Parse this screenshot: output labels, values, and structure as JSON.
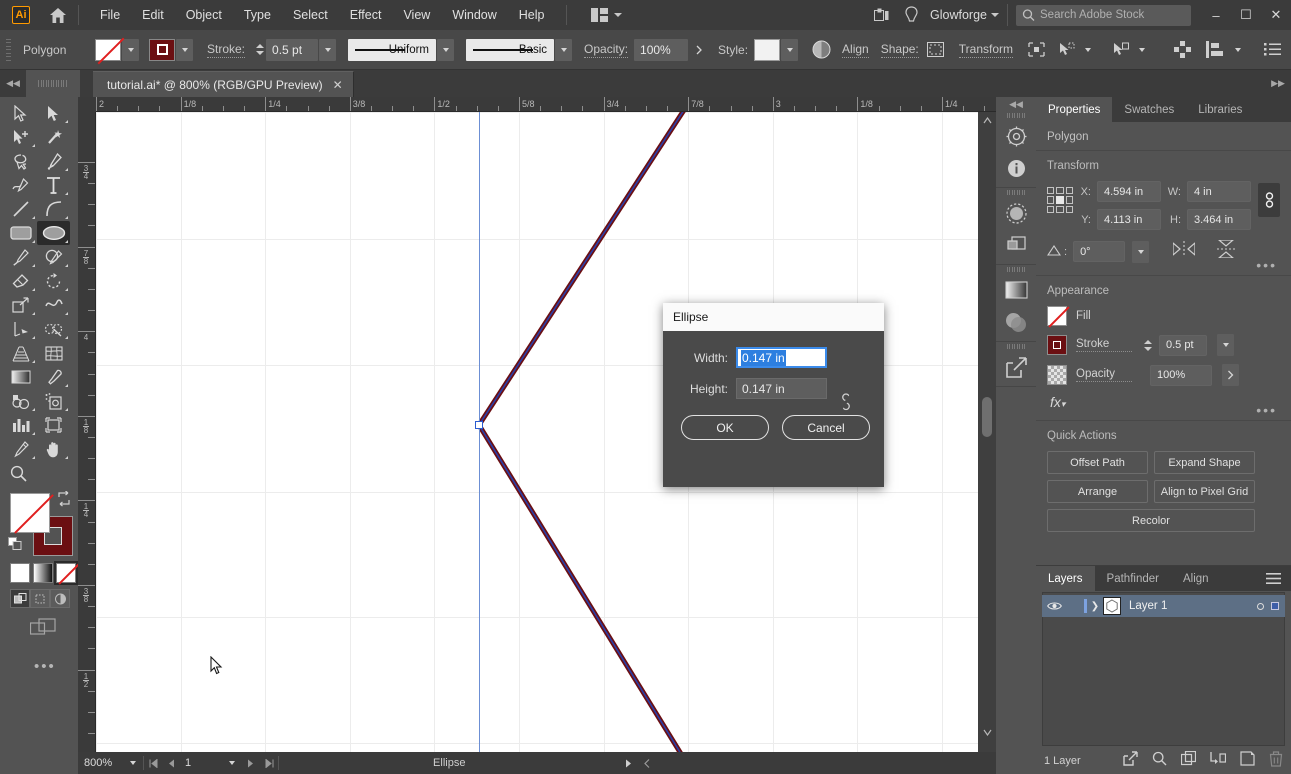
{
  "menubar": {
    "logo": "Ai",
    "items": [
      "File",
      "Edit",
      "Object",
      "Type",
      "Select",
      "Effect",
      "View",
      "Window",
      "Help"
    ],
    "cloud_account": "Glowforge",
    "search_placeholder": "Search Adobe Stock",
    "window_controls": {
      "minimize": "–",
      "maximize": "☐",
      "close": "✕"
    }
  },
  "controlbar": {
    "object_label": "Polygon",
    "stroke_label": "Stroke:",
    "stroke_weight": "0.5 pt",
    "variable_width_profile": "Uniform",
    "brush_definition": "Basic",
    "opacity_label": "Opacity:",
    "opacity_value": "100%",
    "style_label": "Style:",
    "align_label": "Align",
    "shape_label": "Shape:",
    "transform_label": "Transform"
  },
  "tabbar": {
    "document_title": "tutorial.ai* @ 800% (RGB/GPU Preview)",
    "close_glyph": "✕"
  },
  "toolbar": {
    "tools": [
      "selection-tool",
      "direct-selection-tool",
      "group-selection-tool",
      "magic-wand-tool",
      "lasso-tool",
      "pen-tool",
      "curvature-tool",
      "type-tool",
      "line-segment-tool",
      "arc-tool",
      "rectangle-tool",
      "ellipse-tool",
      "paintbrush-tool",
      "shaper-tool",
      "eraser-tool",
      "rotate-tool",
      "scale-tool",
      "width-tool",
      "free-transform-tool",
      "shape-builder-tool",
      "perspective-grid-tool",
      "mesh-tool",
      "gradient-tool",
      "eyedropper-tool",
      "blend-tool",
      "symbol-sprayer-tool",
      "column-graph-tool",
      "artboard-tool",
      "slice-tool",
      "hand-tool",
      "zoom-tool"
    ],
    "active_tool": "ellipse-tool",
    "fill_color": "none",
    "stroke_color": "#6b0f12"
  },
  "rulers": {
    "horizontal_labels": [
      "2",
      "1/8",
      "1/4",
      "3/8",
      "1/2",
      "5/8",
      "3/4",
      "7/8",
      "3",
      "1/8",
      "1/4"
    ],
    "vertical_labels": [
      "3/4",
      "7/8",
      "4",
      "1/8",
      "1/4",
      "3/8",
      "1/2"
    ],
    "units": "in"
  },
  "statusbar": {
    "zoom_level": "800%",
    "page_number": "1",
    "status_text": "Ellipse"
  },
  "dialog": {
    "title": "Ellipse",
    "width_label": "Width:",
    "width_value": "0.147 in",
    "height_label": "Height:",
    "height_value": "0.147 in",
    "ok_label": "OK",
    "cancel_label": "Cancel",
    "constrain_icon": "broken-link-icon"
  },
  "properties": {
    "tabs": [
      "Properties",
      "Swatches",
      "Libraries"
    ],
    "active_tab": "Properties",
    "selection_type": "Polygon",
    "transform": {
      "title": "Transform",
      "x_label": "X:",
      "x_value": "4.594 in",
      "y_label": "Y:",
      "y_value": "4.113 in",
      "w_label": "W:",
      "w_value": "4 in",
      "h_label": "H:",
      "h_value": "3.464 in",
      "angle_value": "0°"
    },
    "appearance": {
      "title": "Appearance",
      "fill_label": "Fill",
      "stroke_label": "Stroke",
      "stroke_weight": "0.5 pt",
      "opacity_label": "Opacity",
      "opacity_value": "100%",
      "fx_label": "fx"
    },
    "quick_actions": {
      "title": "Quick Actions",
      "buttons": [
        "Offset Path",
        "Expand Shape",
        "Arrange",
        "Align to Pixel Grid",
        "Recolor"
      ]
    }
  },
  "layers": {
    "tabs": [
      "Layers",
      "Pathfinder",
      "Align"
    ],
    "active_tab": "Layers",
    "rows": [
      {
        "name": "Layer 1",
        "visible": true,
        "selected": true
      }
    ],
    "footer_count": "1 Layer"
  },
  "colors": {
    "ui_bg": "#535353",
    "panel_bg": "#3b3b3b",
    "accent_blue": "#2d7fe0",
    "stroke_red": "#6b0f12",
    "layer_row": "#5d6f85",
    "canvas_white": "#ffffff",
    "guide_blue": "#6c8fd4"
  }
}
